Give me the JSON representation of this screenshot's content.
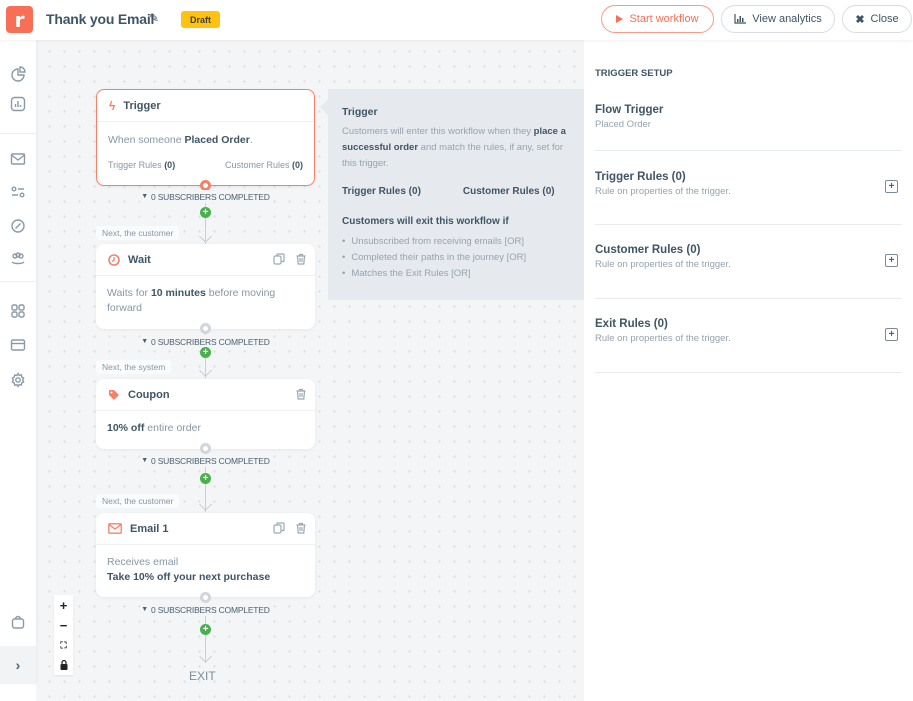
{
  "header": {
    "logo_letter": "r",
    "title": "Thank you Email",
    "edit_icon": "pencil-icon",
    "status_badge": "Draft",
    "buttons": {
      "start": "Start workflow",
      "analytics": "View analytics",
      "close": "Close"
    }
  },
  "sidebar": {
    "icons": [
      "pie-chart-icon",
      "bar-chart-icon",
      "mail-icon",
      "toggles-icon",
      "compass-icon",
      "users-icon",
      "grid-icon",
      "card-icon",
      "gear-icon"
    ],
    "bottom_icons": [
      "bag-icon",
      "chevron-right-icon"
    ],
    "expand_glyph": "›"
  },
  "canvas": {
    "trigger_node": {
      "title": "Trigger",
      "body_prefix": "When someone ",
      "body_bold": "Placed Order",
      "body_suffix": ".",
      "trigger_rules_label": "Trigger Rules ",
      "trigger_rules_count": "(0)",
      "customer_rules_label": "Customer Rules ",
      "customer_rules_count": "(0)"
    },
    "subscribers_completed": "0 SUBSCRIBERS COMPLETED",
    "steps": [
      {
        "next_label": "Next, the customer",
        "title": "Wait",
        "icon": "clock-icon",
        "body_prefix": "Waits for ",
        "body_bold": "10 minutes",
        "body_suffix": " before moving forward"
      },
      {
        "next_label": "Next, the system",
        "title": "Coupon",
        "icon": "tag-icon",
        "body_bold": "10% off",
        "body_suffix": " entire order"
      },
      {
        "next_label": "Next, the customer",
        "title": "Email 1",
        "icon": "envelope-icon",
        "body_line1": "Receives email",
        "body_line2": "Take 10% off your next purchase"
      }
    ],
    "exit_label": "EXIT",
    "zoom_controls": {
      "zoom_in": "+",
      "zoom_out": "−",
      "fit": "⛶",
      "lock": "🔒"
    }
  },
  "info_popover": {
    "title": "Trigger",
    "desc_prefix": "Customers will enter this workflow when they ",
    "desc_bold": "place a successful order",
    "desc_suffix": " and match the rules, if any, set for this trigger.",
    "trigger_rules": "Trigger Rules (0)",
    "customer_rules": "Customer Rules (0)",
    "exit_title": "Customers will exit this workflow if",
    "exit_conditions": [
      "Unsubscribed from receiving emails [OR]",
      "Completed their paths in the journey [OR]",
      "Matches the Exit Rules [OR]"
    ]
  },
  "right_panel": {
    "title": "TRIGGER SETUP",
    "flow_trigger": {
      "heading": "Flow Trigger",
      "value": "Placed Order"
    },
    "sections": [
      {
        "heading": "Trigger Rules (0)",
        "desc": "Rule on properties of the trigger."
      },
      {
        "heading": "Customer Rules (0)",
        "desc": "Rule on properties of the trigger."
      },
      {
        "heading": "Exit Rules (0)",
        "desc": "Rule on properties of the trigger."
      }
    ],
    "add_glyph": "+"
  }
}
